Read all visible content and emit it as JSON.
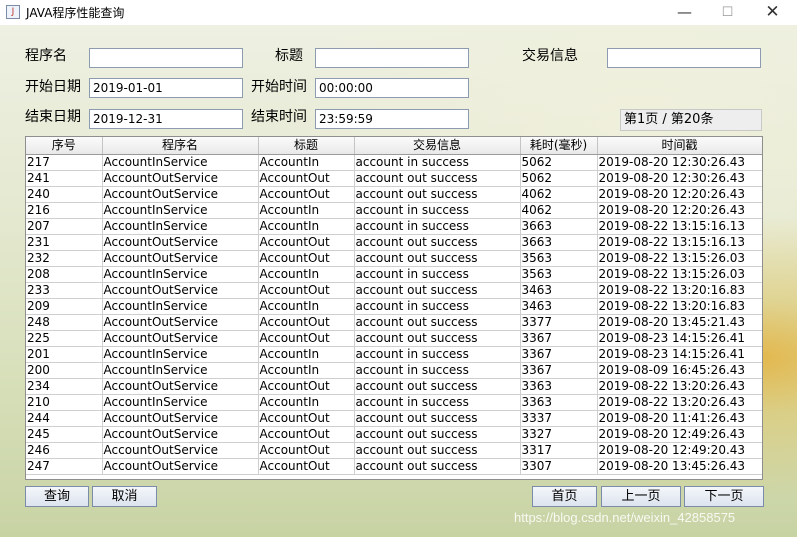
{
  "window": {
    "title": "JAVA程序性能查询",
    "icon_label": "J",
    "min_glyph": "—",
    "max_glyph": "☐",
    "close_glyph": "✕"
  },
  "form": {
    "program_label": "程序名",
    "program_value": "",
    "title_label": "标题",
    "title_value": "",
    "trade_label": "交易信息",
    "trade_value": "",
    "start_date_label": "开始日期",
    "start_date_value": "2019-01-01",
    "start_time_label": "开始时间",
    "start_time_value": "00:00:00",
    "end_date_label": "结束日期",
    "end_date_value": "2019-12-31",
    "end_time_label": "结束时间",
    "end_time_value": "23:59:59",
    "page_info": "第1页 / 第20条"
  },
  "table": {
    "columns": [
      "序号",
      "程序名",
      "标题",
      "交易信息",
      "耗时(毫秒)",
      "时间戳"
    ],
    "rows": [
      [
        "217",
        "AccountInService",
        "AccountIn",
        "account in success",
        "5062",
        "2019-08-20 12:30:26.43"
      ],
      [
        "241",
        "AccountOutService",
        "AccountOut",
        "account out success",
        "5062",
        "2019-08-20 12:30:26.43"
      ],
      [
        "240",
        "AccountOutService",
        "AccountOut",
        "account out success",
        "4062",
        "2019-08-20 12:20:26.43"
      ],
      [
        "216",
        "AccountInService",
        "AccountIn",
        "account in success",
        "4062",
        "2019-08-20 12:20:26.43"
      ],
      [
        "207",
        "AccountInService",
        "AccountIn",
        "account in success",
        "3663",
        "2019-08-22 13:15:16.13"
      ],
      [
        "231",
        "AccountOutService",
        "AccountOut",
        "account out success",
        "3663",
        "2019-08-22 13:15:16.13"
      ],
      [
        "232",
        "AccountOutService",
        "AccountOut",
        "account out success",
        "3563",
        "2019-08-22 13:15:26.03"
      ],
      [
        "208",
        "AccountInService",
        "AccountIn",
        "account in success",
        "3563",
        "2019-08-22 13:15:26.03"
      ],
      [
        "233",
        "AccountOutService",
        "AccountOut",
        "account out success",
        "3463",
        "2019-08-22 13:20:16.83"
      ],
      [
        "209",
        "AccountInService",
        "AccountIn",
        "account in success",
        "3463",
        "2019-08-22 13:20:16.83"
      ],
      [
        "248",
        "AccountOutService",
        "AccountOut",
        "account out success",
        "3377",
        "2019-08-20 13:45:21.43"
      ],
      [
        "225",
        "AccountOutService",
        "AccountOut",
        "account out success",
        "3367",
        "2019-08-23 14:15:26.41"
      ],
      [
        "201",
        "AccountInService",
        "AccountIn",
        "account in success",
        "3367",
        "2019-08-23 14:15:26.41"
      ],
      [
        "200",
        "AccountInService",
        "AccountIn",
        "account in success",
        "3367",
        "2019-08-09 16:45:26.43"
      ],
      [
        "234",
        "AccountOutService",
        "AccountOut",
        "account out success",
        "3363",
        "2019-08-22 13:20:26.43"
      ],
      [
        "210",
        "AccountInService",
        "AccountIn",
        "account in success",
        "3363",
        "2019-08-22 13:20:26.43"
      ],
      [
        "244",
        "AccountOutService",
        "AccountOut",
        "account out success",
        "3337",
        "2019-08-20 11:41:26.43"
      ],
      [
        "245",
        "AccountOutService",
        "AccountOut",
        "account out success",
        "3327",
        "2019-08-20 12:49:26.43"
      ],
      [
        "246",
        "AccountOutService",
        "AccountOut",
        "account out success",
        "3317",
        "2019-08-20 12:49:20.43"
      ],
      [
        "247",
        "AccountOutService",
        "AccountOut",
        "account out success",
        "3307",
        "2019-08-20 13:45:26.43"
      ]
    ]
  },
  "buttons": {
    "query": "查询",
    "cancel": "取消",
    "first": "首页",
    "prev": "上一页",
    "next": "下一页"
  },
  "watermark": "https://blog.csdn.net/weixin_42858575"
}
